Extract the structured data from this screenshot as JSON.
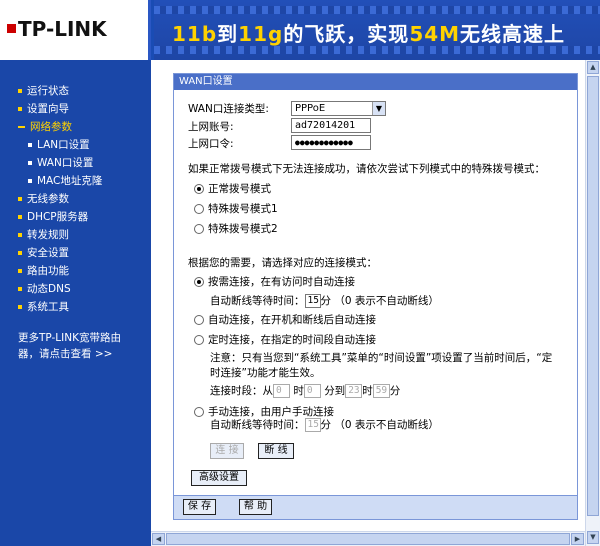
{
  "header": {
    "brand": "TP-LINK",
    "slogan_parts": [
      "11b",
      "到",
      "11g",
      "的飞跃，实现",
      "54M",
      "无线高速上"
    ]
  },
  "sidebar": {
    "items": [
      {
        "label": "运行状态",
        "level": 0,
        "active": false
      },
      {
        "label": "设置向导",
        "level": 0,
        "active": false
      },
      {
        "label": "网络参数",
        "level": 0,
        "active": true
      },
      {
        "label": "LAN口设置",
        "level": 1,
        "active": false
      },
      {
        "label": "WAN口设置",
        "level": 1,
        "active": false
      },
      {
        "label": "MAC地址克隆",
        "level": 1,
        "active": false
      },
      {
        "label": "无线参数",
        "level": 0,
        "active": false
      },
      {
        "label": "DHCP服务器",
        "level": 0,
        "active": false
      },
      {
        "label": "转发规则",
        "level": 0,
        "active": false
      },
      {
        "label": "安全设置",
        "level": 0,
        "active": false
      },
      {
        "label": "路由功能",
        "level": 0,
        "active": false
      },
      {
        "label": "动态DNS",
        "level": 0,
        "active": false
      },
      {
        "label": "系统工具",
        "level": 0,
        "active": false
      }
    ],
    "more_line1": "更多TP-LINK宽带路由",
    "more_line2": "器，请点击查看 >>"
  },
  "panel": {
    "title": "WAN口设置",
    "wan_type_label": "WAN口连接类型:",
    "wan_type_value": "PPPoE",
    "account_label": "上网账号:",
    "account_value": "ad72014201",
    "password_label": "上网口令:",
    "password_value": "●●●●●●●●●●●●",
    "dial_hint": "如果正常拨号模式下无法连接成功，请依次尝试下列模式中的特殊拨号模式：",
    "dial_modes": [
      "正常拨号模式",
      "特殊拨号模式1",
      "特殊拨号模式2"
    ],
    "connect_hint": "根据您的需要，请选择对应的连接模式：",
    "mode_on_demand": "按需连接，在有访问时自动连接",
    "idle_label": "自动断线等待时间：",
    "idle_value": "15",
    "idle_unit": "分",
    "idle_note": "（0 表示不自动断线）",
    "mode_auto": "自动连接，在开机和断线后自动连接",
    "mode_timed": "定时连接，在指定的时间段自动连接",
    "timed_note_1": "注意：只有当您到“系统工具”菜单的“时间设置”项设置了当前时间后，“定",
    "timed_note_2": "时连接”功能才能生效。",
    "period_label": "连接时段：从",
    "period_h1": "0",
    "period_hour": "时",
    "period_m1": "0",
    "period_to": "分到",
    "period_h2": "23",
    "period_m2": "59",
    "period_min": "分",
    "mode_manual": "手动连接，由用户手动连接",
    "manual_idle_label": "自动断线等待时间：",
    "manual_idle_value": "15",
    "manual_idle_unit": "分",
    "manual_idle_note": "（0 表示不自动断线）",
    "connect_btn": "连 接",
    "disconnect_btn": "断 线",
    "advanced_btn": "高级设置",
    "save_btn": "保 存",
    "help_btn": "帮 助"
  }
}
